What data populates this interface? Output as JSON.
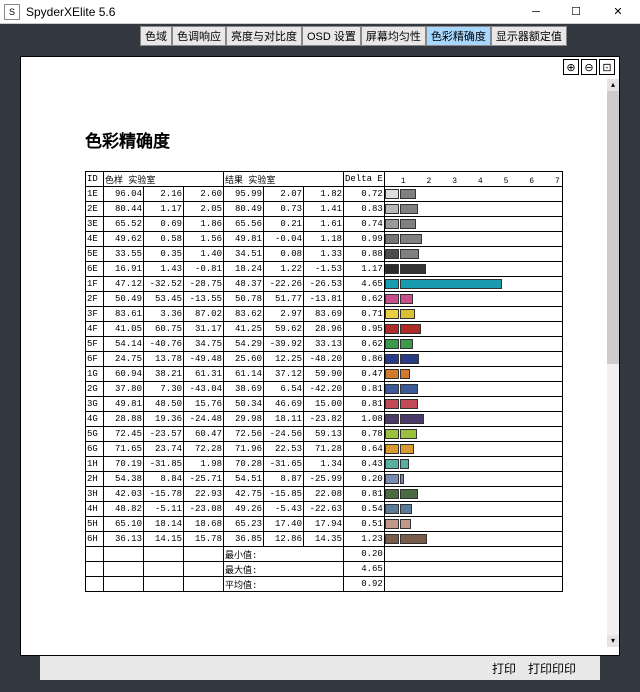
{
  "window": {
    "title": "SpyderXElite 5.6",
    "icon_label": "S"
  },
  "tabs": [
    "色域",
    "色调响应",
    "亮度与对比度",
    "OSD 设置",
    "屏幕均匀性",
    "色彩精确度",
    "显示器额定值"
  ],
  "active_tab_index": 5,
  "page_title": "色彩精确度",
  "columns": {
    "id": "ID",
    "sample": "色样 实验室",
    "result": "结果 实验室",
    "delta": "Delta E",
    "ticks": [
      "1",
      "2",
      "3",
      "4",
      "5",
      "6",
      "7"
    ]
  },
  "rows": [
    {
      "id": "1E",
      "s": [
        "96.04",
        "2.16",
        "2.60"
      ],
      "r": [
        "95.99",
        "2.07",
        "1.82"
      ],
      "de": "0.72",
      "swatch": "#dcdcdc",
      "bar": "#808080"
    },
    {
      "id": "2E",
      "s": [
        "80.44",
        "1.17",
        "2.05"
      ],
      "r": [
        "80.49",
        "0.73",
        "1.41"
      ],
      "de": "0.83",
      "swatch": "#b8b8b8",
      "bar": "#808080"
    },
    {
      "id": "3E",
      "s": [
        "65.52",
        "0.69",
        "1.86"
      ],
      "r": [
        "65.56",
        "0.21",
        "1.61"
      ],
      "de": "0.74",
      "swatch": "#9a9a9a",
      "bar": "#808080"
    },
    {
      "id": "4E",
      "s": [
        "49.62",
        "0.58",
        "1.56"
      ],
      "r": [
        "49.81",
        "-0.04",
        "1.18"
      ],
      "de": "0.99",
      "swatch": "#757575",
      "bar": "#808080"
    },
    {
      "id": "5E",
      "s": [
        "33.55",
        "0.35",
        "1.40"
      ],
      "r": [
        "34.51",
        "0.08",
        "1.33"
      ],
      "de": "0.88",
      "swatch": "#4e4e4e",
      "bar": "#808080"
    },
    {
      "id": "6E",
      "s": [
        "16.91",
        "1.43",
        "-0.81"
      ],
      "r": [
        "18.24",
        "1.22",
        "-1.53"
      ],
      "de": "1.17",
      "swatch": "#2a2a2a",
      "bar": "#333333"
    },
    {
      "id": "1F",
      "s": [
        "47.12",
        "-32.52",
        "-28.75"
      ],
      "r": [
        "48.37",
        "-22.26",
        "-26.53"
      ],
      "de": "4.65",
      "swatch": "#1a9cb0",
      "bar": "#1a9cb0"
    },
    {
      "id": "2F",
      "s": [
        "50.49",
        "53.45",
        "-13.55"
      ],
      "r": [
        "50.78",
        "51.77",
        "-13.81"
      ],
      "de": "0.62",
      "swatch": "#c84f8c",
      "bar": "#c84f8c"
    },
    {
      "id": "3F",
      "s": [
        "83.61",
        "3.36",
        "87.02"
      ],
      "r": [
        "83.62",
        "2.97",
        "83.69"
      ],
      "de": "0.71",
      "swatch": "#e8d040",
      "bar": "#d8c030"
    },
    {
      "id": "4F",
      "s": [
        "41.05",
        "60.75",
        "31.17"
      ],
      "r": [
        "41.25",
        "59.62",
        "28.96"
      ],
      "de": "0.95",
      "swatch": "#b02a28",
      "bar": "#b02a28"
    },
    {
      "id": "5F",
      "s": [
        "54.14",
        "-40.76",
        "34.75"
      ],
      "r": [
        "54.29",
        "-39.92",
        "33.13"
      ],
      "de": "0.62",
      "swatch": "#3a9a4a",
      "bar": "#3a9a4a"
    },
    {
      "id": "6F",
      "s": [
        "24.75",
        "13.78",
        "-49.48"
      ],
      "r": [
        "25.60",
        "12.25",
        "-48.20"
      ],
      "de": "0.86",
      "swatch": "#2a3a8a",
      "bar": "#2a3a8a"
    },
    {
      "id": "1G",
      "s": [
        "60.94",
        "38.21",
        "61.31"
      ],
      "r": [
        "61.14",
        "37.12",
        "59.90"
      ],
      "de": "0.47",
      "swatch": "#d07a30",
      "bar": "#d07a30"
    },
    {
      "id": "2G",
      "s": [
        "37.80",
        "7.30",
        "-43.04"
      ],
      "r": [
        "38.69",
        "6.54",
        "-42.20"
      ],
      "de": "0.81",
      "swatch": "#3a5a9a",
      "bar": "#3a5a9a"
    },
    {
      "id": "3G",
      "s": [
        "49.81",
        "48.50",
        "15.76"
      ],
      "r": [
        "50.34",
        "46.69",
        "15.00"
      ],
      "de": "0.81",
      "swatch": "#c04a58",
      "bar": "#c04a58"
    },
    {
      "id": "4G",
      "s": [
        "28.88",
        "19.36",
        "-24.48"
      ],
      "r": [
        "29.98",
        "18.11",
        "-23.82"
      ],
      "de": "1.08",
      "swatch": "#4a3a6a",
      "bar": "#4a3a6a"
    },
    {
      "id": "5G",
      "s": [
        "72.45",
        "-23.57",
        "60.47"
      ],
      "r": [
        "72.56",
        "-24.56",
        "59.13"
      ],
      "de": "0.78",
      "swatch": "#9ac040",
      "bar": "#9ac040"
    },
    {
      "id": "6G",
      "s": [
        "71.65",
        "23.74",
        "72.28"
      ],
      "r": [
        "71.96",
        "22.53",
        "71.28"
      ],
      "de": "0.64",
      "swatch": "#d89a30",
      "bar": "#d89a30"
    },
    {
      "id": "1H",
      "s": [
        "70.19",
        "-31.85",
        "1.98"
      ],
      "r": [
        "70.28",
        "-31.65",
        "1.34"
      ],
      "de": "0.43",
      "swatch": "#5ab0a0",
      "bar": "#5ab0a0"
    },
    {
      "id": "2H",
      "s": [
        "54.38",
        "8.84",
        "-25.71"
      ],
      "r": [
        "54.51",
        "8.87",
        "-25.99"
      ],
      "de": "0.20",
      "swatch": "#7a8ab0",
      "bar": "#7a8ab0"
    },
    {
      "id": "3H",
      "s": [
        "42.03",
        "-15.78",
        "22.93"
      ],
      "r": [
        "42.75",
        "-15.85",
        "22.08"
      ],
      "de": "0.81",
      "swatch": "#4a6a40",
      "bar": "#4a6a40"
    },
    {
      "id": "4H",
      "s": [
        "48.82",
        "-5.11",
        "-23.08"
      ],
      "r": [
        "49.26",
        "-5.43",
        "-22.63"
      ],
      "de": "0.54",
      "swatch": "#5a7a9a",
      "bar": "#5a7a9a"
    },
    {
      "id": "5H",
      "s": [
        "65.10",
        "18.14",
        "18.68"
      ],
      "r": [
        "65.23",
        "17.40",
        "17.94"
      ],
      "de": "0.51",
      "swatch": "#c09a88",
      "bar": "#c09a88"
    },
    {
      "id": "6H",
      "s": [
        "36.13",
        "14.15",
        "15.78"
      ],
      "r": [
        "36.85",
        "12.86",
        "14.35"
      ],
      "de": "1.23",
      "swatch": "#7a5a48",
      "bar": "#7a5a48"
    }
  ],
  "summary": [
    {
      "label": "最小值:",
      "value": "0.20"
    },
    {
      "label": "最大值:",
      "value": "4.65"
    },
    {
      "label": "平均值:",
      "value": "0.92"
    }
  ],
  "footer": {
    "print": "打印",
    "print2": "打印印印"
  },
  "chart_data": {
    "type": "bar",
    "title": "Delta E",
    "xlabel": "",
    "ylabel": "",
    "ylim": [
      0,
      7
    ],
    "categories": [
      "1E",
      "2E",
      "3E",
      "4E",
      "5E",
      "6E",
      "1F",
      "2F",
      "3F",
      "4F",
      "5F",
      "6F",
      "1G",
      "2G",
      "3G",
      "4G",
      "5G",
      "6G",
      "1H",
      "2H",
      "3H",
      "4H",
      "5H",
      "6H"
    ],
    "values": [
      0.72,
      0.83,
      0.74,
      0.99,
      0.88,
      1.17,
      4.65,
      0.62,
      0.71,
      0.95,
      0.62,
      0.86,
      0.47,
      0.81,
      0.81,
      1.08,
      0.78,
      0.64,
      0.43,
      0.2,
      0.81,
      0.54,
      0.51,
      1.23
    ]
  }
}
